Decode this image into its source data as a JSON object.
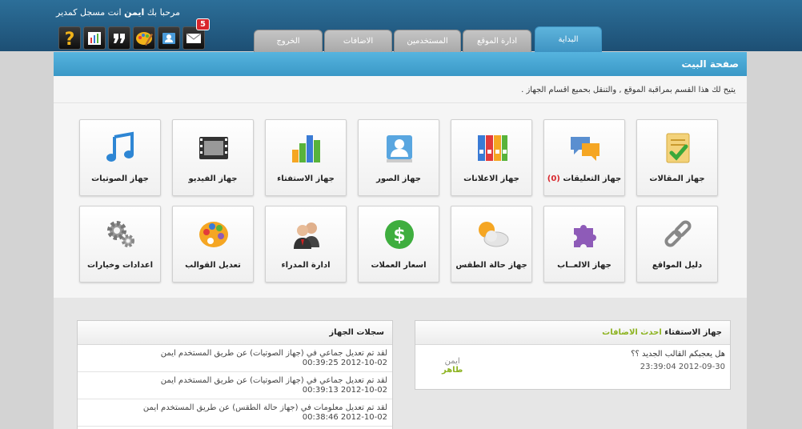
{
  "header": {
    "welcome_prefix": "مرحبا بك",
    "welcome_name": "ايمن",
    "welcome_suffix": "انت مسجل كمدير",
    "notification_count": "5",
    "toolbar_icons": [
      "help-icon",
      "chart-icon",
      "quote-icon",
      "palette-icon",
      "contact-card-icon",
      "mail-icon"
    ]
  },
  "tabs": [
    {
      "label": "البداية",
      "active": true
    },
    {
      "label": "ادارة الموقع",
      "active": false
    },
    {
      "label": "المستخدمين",
      "active": false
    },
    {
      "label": "الاضافات",
      "active": false
    },
    {
      "label": "الخروج",
      "active": false
    }
  ],
  "page": {
    "title": "صفحة البيت",
    "description": "يتيح لك هذا القسم بمراقبة الموقع , والتنقل بحميع اقسام الجهاز ."
  },
  "tiles": [
    {
      "label": "جهاز المقالات",
      "icon": "article-icon"
    },
    {
      "label": "جهاز التعليقات",
      "count": "(0)",
      "icon": "comments-icon"
    },
    {
      "label": "جهاز الاعلانات",
      "icon": "binders-icon"
    },
    {
      "label": "جهاز الصور",
      "icon": "photo-icon"
    },
    {
      "label": "جهاز الاستفتاء",
      "icon": "bar-chart-icon"
    },
    {
      "label": "جهاز الفيديو",
      "icon": "film-icon"
    },
    {
      "label": "جهاز الصوتيات",
      "icon": "music-note-icon"
    },
    {
      "label": "دليل المواقع",
      "icon": "link-icon"
    },
    {
      "label": "جهاز الالعــاب",
      "icon": "puzzle-icon"
    },
    {
      "label": "جهاز حالة الطقس",
      "icon": "weather-icon"
    },
    {
      "label": "اسعار العملات",
      "icon": "dollar-icon"
    },
    {
      "label": "ادارة المدراء",
      "icon": "users-icon"
    },
    {
      "label": "تعديل القوالب",
      "icon": "palette-icon"
    },
    {
      "label": "اعدادات وخيارات",
      "icon": "gears-icon"
    }
  ],
  "poll_box": {
    "title": "جهاز الاستفتاء",
    "subtitle": "احدث الاضافات",
    "question": "هل يعجبكم القالب الجديد ؟؟",
    "datetime": "2012-09-30 23:39:04",
    "user_label": "ايمن",
    "user_name": "طاهر"
  },
  "log_box": {
    "title": "سجلات الجهاز",
    "entries": [
      {
        "text": "لقد تم تعديل جماعي في (جهاز الصوتيات) عن طريق المستخدم ايمن",
        "date": "2012-10-02 00:39:25"
      },
      {
        "text": "لقد تم تعديل جماعي في (جهاز الصوتيات) عن طريق المستخدم ايمن",
        "date": "2012-10-02 00:39:13"
      },
      {
        "text": "لقد تم تعديل معلومات في (جهاز حالة الطقس) عن طريق المستخدم ايمن",
        "date": "2012-10-02 00:38:46"
      }
    ]
  },
  "colors": {
    "accent": "#3a98c6",
    "header": "#1d4f74",
    "badge": "#d8262c",
    "green": "#8db321"
  }
}
